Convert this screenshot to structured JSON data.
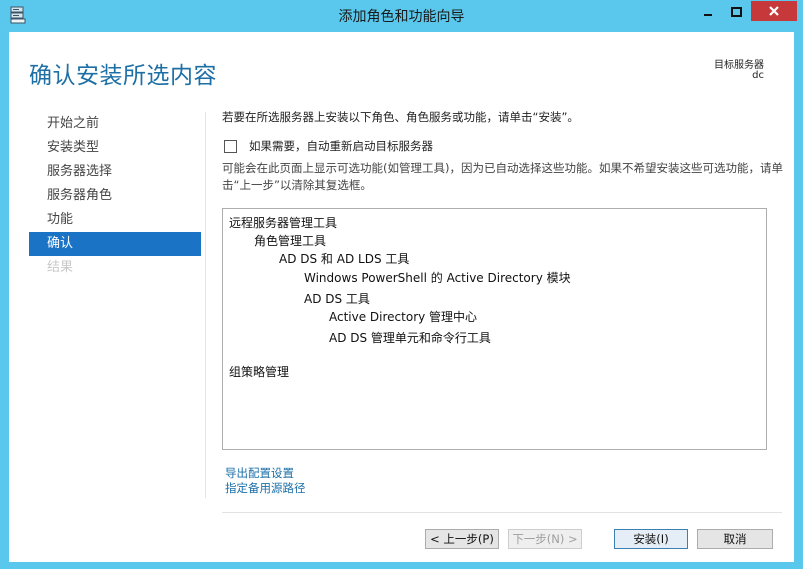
{
  "window": {
    "title": "添加角色和功能向导"
  },
  "page": {
    "title": "确认安装所选内容",
    "target_label": "目标服务器",
    "target_value": "dc"
  },
  "nav": {
    "items": [
      {
        "label": "开始之前",
        "state": "normal"
      },
      {
        "label": "安装类型",
        "state": "normal"
      },
      {
        "label": "服务器选择",
        "state": "normal"
      },
      {
        "label": "服务器角色",
        "state": "normal"
      },
      {
        "label": "功能",
        "state": "normal"
      },
      {
        "label": "确认",
        "state": "active"
      },
      {
        "label": "结果",
        "state": "disabled"
      }
    ]
  },
  "main": {
    "intro": "若要在所选服务器上安装以下角色、角色服务或功能，请单击“安装”。",
    "restart_label": "如果需要，自动重新启动目标服务器",
    "restart_checked": false,
    "note": "可能会在此页面上显示可选功能(如管理工具)，因为已自动选择这些功能。如果不希望安装这些可选功能，请单击“上一步”以清除其复选框。",
    "features": [
      {
        "label": "远程服务器管理工具",
        "level": 0
      },
      {
        "label": "角色管理工具",
        "level": 1
      },
      {
        "label": "AD DS 和 AD LDS 工具",
        "level": 2
      },
      {
        "label": "Windows PowerShell 的 Active Directory 模块",
        "level": 3
      },
      {
        "label": "AD DS 工具",
        "level": 3
      },
      {
        "label": "Active Directory 管理中心",
        "level": 4
      },
      {
        "label": "AD DS 管理单元和命令行工具",
        "level": 4
      },
      {
        "label": "组策略管理",
        "level": 0
      }
    ],
    "links": {
      "export": "导出配置设置",
      "alt_source": "指定备用源路径"
    }
  },
  "footer": {
    "prev_label": "< 上一步(P)",
    "next_label": "下一步(N) >",
    "install_label": "安装(I)",
    "cancel_label": "取消"
  },
  "colors": {
    "titlebar": "#59c8ec",
    "close_button": "#c7383a",
    "accent": "#1a73c5",
    "title": "#1d6fa5",
    "link": "#1a6fa8"
  }
}
